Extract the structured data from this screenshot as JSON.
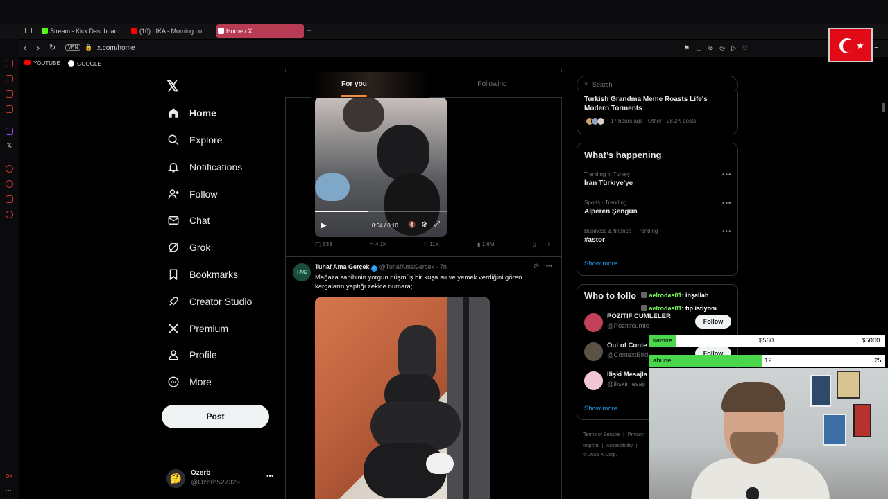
{
  "browser": {
    "tabs": [
      {
        "label": "Stream - Kick Dashboard",
        "color": "#53fc18"
      },
      {
        "label": "(10) LIKA - Morning co",
        "color": "#ff0000"
      },
      {
        "label": "Home / X",
        "color": "#ffffff"
      }
    ],
    "vpn": "VPN",
    "url": "x.com/home",
    "bookmarks": [
      "YOUTUBE",
      "GOOGLE"
    ]
  },
  "nav": {
    "items": [
      {
        "label": "Home",
        "icon": "home-icon"
      },
      {
        "label": "Explore",
        "icon": "search-icon"
      },
      {
        "label": "Notifications",
        "icon": "bell-icon"
      },
      {
        "label": "Follow",
        "icon": "follow-icon"
      },
      {
        "label": "Chat",
        "icon": "mail-icon"
      },
      {
        "label": "Grok",
        "icon": "grok-icon"
      },
      {
        "label": "Bookmarks",
        "icon": "bookmark-icon"
      },
      {
        "label": "Creator Studio",
        "icon": "rocket-icon"
      },
      {
        "label": "Premium",
        "icon": "x-logo-icon"
      },
      {
        "label": "Profile",
        "icon": "person-icon"
      },
      {
        "label": "More",
        "icon": "more-circle-icon"
      }
    ],
    "post": "Post",
    "account": {
      "name": "Ozerb",
      "handle": "@Ozerb527329",
      "avatar": "🤔"
    }
  },
  "timeline": {
    "tabs": [
      "For you",
      "Following"
    ],
    "video_post": {
      "time": "0:04 / 0:10",
      "stats": {
        "replies": "833",
        "reposts": "4.1K",
        "likes": "11K",
        "views": "1.6M"
      }
    },
    "tweet": {
      "avatar": "TAG",
      "name": "Tuhaf Ama Gerçek",
      "handle": "@TuhafAmaGercek",
      "time": "· 7h",
      "text": "Mağaza sahibinin yorgun düşmüş bir kuşa su ve yemek verdiğini gören kargaların yaptığı zekice numara;"
    }
  },
  "right": {
    "search_placeholder": "Search",
    "top_news": {
      "title": "Turkish Grandma Meme Roasts Life's Modern Torments",
      "meta": "17 hours ago · Other · 28.2K posts"
    },
    "happening": {
      "title": "What’s happening",
      "trends": [
        {
          "sub": "Trending in Turkey",
          "title": "İran Türkiye'ye"
        },
        {
          "sub": "Sports · Trending",
          "title": "Alperen Şengün"
        },
        {
          "sub": "Business & finance · Trending",
          "title": "#astor"
        }
      ],
      "show_more": "Show more"
    },
    "who": {
      "title": "Who to follo",
      "accounts": [
        {
          "name": "POZİTİF CÜMLELER",
          "handle": "@Pozitifcumle",
          "button": "Follow"
        },
        {
          "name": "Out of Conte",
          "handle": "@ContextBird",
          "button": "Follow"
        },
        {
          "name": "İlişki Mesajla",
          "handle": "@iliskimesaji",
          "button": ""
        }
      ],
      "show_more": "Show more"
    },
    "footer": {
      "line1": [
        "Terms of Service",
        "|",
        "Privacy"
      ],
      "line2": [
        "Imprint",
        "|",
        "Accessibility",
        "|"
      ],
      "copyright": "© 2026 X Corp."
    }
  },
  "overlay": {
    "chat": [
      {
        "user": "aelrodas01",
        "msg": ": inşallah"
      },
      {
        "user": "aelrodas01",
        "msg": ": tıp istiyom"
      }
    ],
    "goals": [
      {
        "label": "kamira",
        "current": "$560",
        "target": "$5000",
        "progress": 0.112
      },
      {
        "label": "abune",
        "current": "12",
        "target": "25",
        "progress": 0.48
      }
    ]
  },
  "colors": {
    "accent": "#1d9bf0",
    "opera_red": "#c0392b",
    "goal_green": "#4bd74b"
  }
}
